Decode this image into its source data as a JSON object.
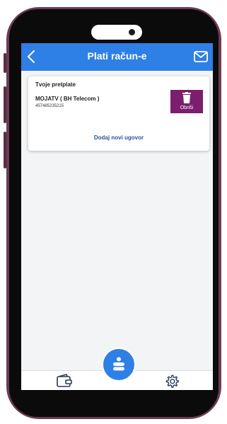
{
  "header": {
    "title": "Plati račun-e",
    "back_icon": "chevron-left-icon",
    "mail_icon": "mail-icon"
  },
  "subscriptions": {
    "section_title": "Tvoje pretplate",
    "items": [
      {
        "name": "MOJATV ( BH Telecom )",
        "number": "457485235215",
        "delete_label": "Obriši"
      }
    ],
    "add_link": "Dodaj novi ugovor"
  },
  "bottom_nav": {
    "left_icon": "wallet-icon",
    "center_icon": "bank-logo-icon",
    "right_icon": "gear-icon"
  },
  "colors": {
    "header": "#2e7fe6",
    "delete_button": "#7b1e6d",
    "link": "#2b5597",
    "screen_bg": "#f3f4f6",
    "phone_frame": "#6b3c54"
  }
}
